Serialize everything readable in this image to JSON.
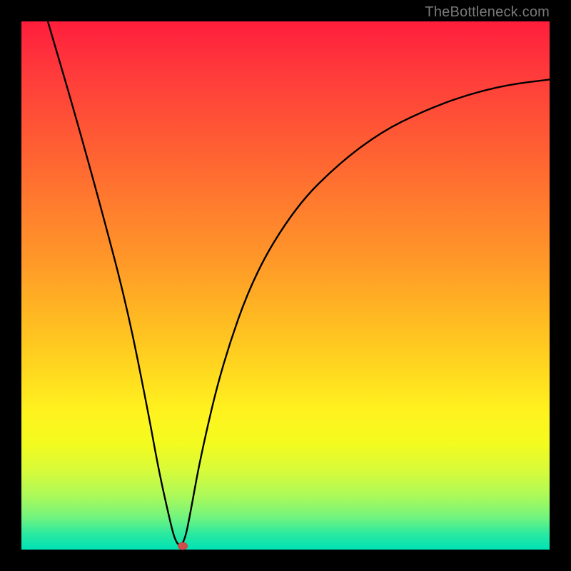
{
  "watermark": "TheBottleneck.com",
  "chart_data": {
    "type": "line",
    "title": "",
    "xlabel": "",
    "ylabel": "",
    "xlim": [
      0,
      100
    ],
    "ylim": [
      0,
      100
    ],
    "grid": false,
    "series": [
      {
        "name": "curve",
        "x": [
          5,
          10,
          15,
          20,
          24,
          26,
          28,
          29,
          30,
          31,
          32,
          34,
          38,
          44,
          52,
          60,
          68,
          76,
          84,
          92,
          100
        ],
        "values": [
          100,
          83,
          65,
          46,
          26,
          15,
          6,
          2,
          0.5,
          2,
          7,
          18,
          35,
          52,
          65,
          73,
          79,
          83,
          86,
          88,
          89
        ]
      }
    ],
    "marker": {
      "x": 30.5,
      "y": 0.7
    },
    "gradient_stops": [
      {
        "pos": 0,
        "color": "#ff1e3c"
      },
      {
        "pos": 10,
        "color": "#ff3b3b"
      },
      {
        "pos": 22,
        "color": "#ff5a34"
      },
      {
        "pos": 34,
        "color": "#ff7a2e"
      },
      {
        "pos": 46,
        "color": "#ff9a28"
      },
      {
        "pos": 56,
        "color": "#ffb922"
      },
      {
        "pos": 66,
        "color": "#ffd81f"
      },
      {
        "pos": 74,
        "color": "#fff31f"
      },
      {
        "pos": 80,
        "color": "#f3fb1f"
      },
      {
        "pos": 85,
        "color": "#d8fb3a"
      },
      {
        "pos": 90,
        "color": "#aaf95a"
      },
      {
        "pos": 94,
        "color": "#70f47f"
      },
      {
        "pos": 97,
        "color": "#2be9a0"
      },
      {
        "pos": 100,
        "color": "#00e2b5"
      }
    ]
  }
}
